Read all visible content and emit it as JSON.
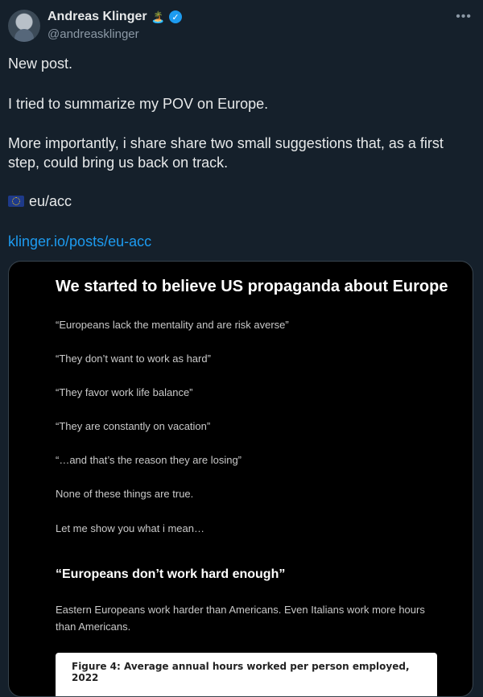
{
  "author": {
    "display_name": "Andreas Klinger",
    "emoji": "🏝️",
    "handle": "@andreasklinger"
  },
  "more_menu": "•••",
  "tweet": {
    "lines": [
      "New post.",
      "I tried to summarize my POV on Europe.",
      "More importantly, i share share two small suggestions that, as a first step, could bring us back on track.",
      "eu/acc"
    ],
    "link": "klinger.io/posts/eu-acc"
  },
  "card": {
    "title": "We started to believe US propaganda about Europe",
    "quotes": [
      "“Europeans lack the mentality and are risk averse”",
      "“They don’t want to work as hard”",
      "“They favor work life balance”",
      "“They are constantly on vacation”",
      "“…and that’s the reason they are losing”",
      "None of these things are true.",
      "Let me show you what i mean…"
    ],
    "subheading": "“Europeans don’t work hard enough”",
    "paragraph": "Eastern Europeans work harder than Americans. Even Italians work more hours than Americans.",
    "figure_caption": "Figure 4: Average annual hours worked per person employed, 2022"
  },
  "colors": {
    "background": "#15202b",
    "link": "#1d9bf0",
    "verified": "#1d9bf0"
  }
}
